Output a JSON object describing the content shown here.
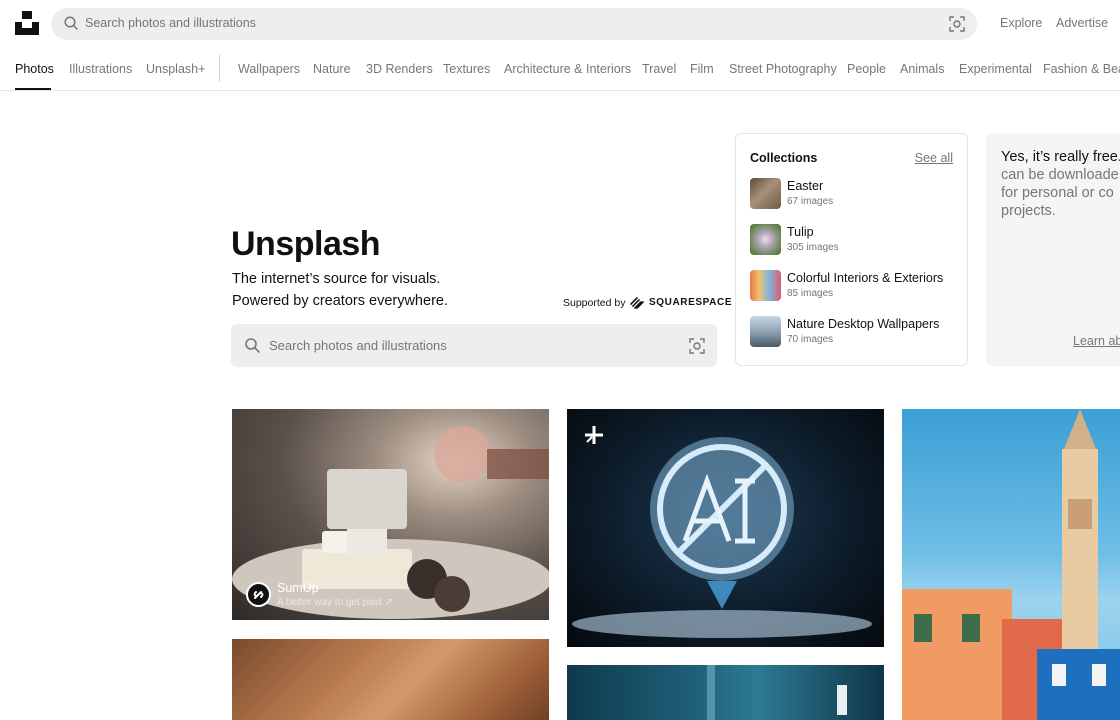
{
  "header": {
    "search_placeholder": "Search photos and illustrations",
    "links": {
      "explore": "Explore",
      "advertise": "Advertise"
    }
  },
  "nav": {
    "primary": [
      "Photos",
      "Illustrations",
      "Unsplash+"
    ],
    "topics": [
      "Wallpapers",
      "Nature",
      "3D Renders",
      "Textures",
      "Architecture & Interiors",
      "Travel",
      "Film",
      "Street Photography",
      "People",
      "Animals",
      "Experimental",
      "Fashion & Beau"
    ],
    "active": "Photos"
  },
  "hero": {
    "title": "Unsplash",
    "subtitle_line1": "The internet’s source for visuals.",
    "subtitle_line2": "Powered by creators everywhere.",
    "supported_by": "Supported by",
    "sponsor_brand": "SQUARESPACE",
    "search_placeholder": "Search photos and illustrations"
  },
  "collections": {
    "title": "Collections",
    "see_all": "See all",
    "items": [
      {
        "name": "Easter",
        "count": "67 images"
      },
      {
        "name": "Tulip",
        "count": "305 images"
      },
      {
        "name": "Colorful Interiors & Exteriors",
        "count": "85 images"
      },
      {
        "name": "Nature Desktop Wallpapers",
        "count": "70 images"
      }
    ]
  },
  "free_card": {
    "line1": "Yes, it’s really free.",
    "line2": "can be downloade",
    "line3": "for personal or co",
    "line4": "projects.",
    "learn": "Learn ab"
  },
  "sponsored_photo": {
    "name": "SumUp",
    "tagline": "A better way to get paid ↗"
  },
  "icons": [
    "unsplash-logo",
    "search-icon",
    "visual-search-icon",
    "squarespace-logo",
    "unsplash-plus-icon"
  ]
}
